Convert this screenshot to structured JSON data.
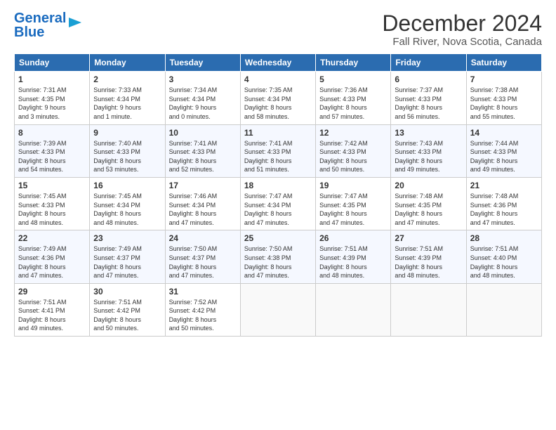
{
  "header": {
    "logo_line1": "General",
    "logo_line2": "Blue",
    "month_title": "December 2024",
    "location": "Fall River, Nova Scotia, Canada"
  },
  "days_of_week": [
    "Sunday",
    "Monday",
    "Tuesday",
    "Wednesday",
    "Thursday",
    "Friday",
    "Saturday"
  ],
  "weeks": [
    [
      {
        "day": "1",
        "info": "Sunrise: 7:31 AM\nSunset: 4:35 PM\nDaylight: 9 hours\nand 3 minutes."
      },
      {
        "day": "2",
        "info": "Sunrise: 7:33 AM\nSunset: 4:34 PM\nDaylight: 9 hours\nand 1 minute."
      },
      {
        "day": "3",
        "info": "Sunrise: 7:34 AM\nSunset: 4:34 PM\nDaylight: 9 hours\nand 0 minutes."
      },
      {
        "day": "4",
        "info": "Sunrise: 7:35 AM\nSunset: 4:34 PM\nDaylight: 8 hours\nand 58 minutes."
      },
      {
        "day": "5",
        "info": "Sunrise: 7:36 AM\nSunset: 4:33 PM\nDaylight: 8 hours\nand 57 minutes."
      },
      {
        "day": "6",
        "info": "Sunrise: 7:37 AM\nSunset: 4:33 PM\nDaylight: 8 hours\nand 56 minutes."
      },
      {
        "day": "7",
        "info": "Sunrise: 7:38 AM\nSunset: 4:33 PM\nDaylight: 8 hours\nand 55 minutes."
      }
    ],
    [
      {
        "day": "8",
        "info": "Sunrise: 7:39 AM\nSunset: 4:33 PM\nDaylight: 8 hours\nand 54 minutes."
      },
      {
        "day": "9",
        "info": "Sunrise: 7:40 AM\nSunset: 4:33 PM\nDaylight: 8 hours\nand 53 minutes."
      },
      {
        "day": "10",
        "info": "Sunrise: 7:41 AM\nSunset: 4:33 PM\nDaylight: 8 hours\nand 52 minutes."
      },
      {
        "day": "11",
        "info": "Sunrise: 7:41 AM\nSunset: 4:33 PM\nDaylight: 8 hours\nand 51 minutes."
      },
      {
        "day": "12",
        "info": "Sunrise: 7:42 AM\nSunset: 4:33 PM\nDaylight: 8 hours\nand 50 minutes."
      },
      {
        "day": "13",
        "info": "Sunrise: 7:43 AM\nSunset: 4:33 PM\nDaylight: 8 hours\nand 49 minutes."
      },
      {
        "day": "14",
        "info": "Sunrise: 7:44 AM\nSunset: 4:33 PM\nDaylight: 8 hours\nand 49 minutes."
      }
    ],
    [
      {
        "day": "15",
        "info": "Sunrise: 7:45 AM\nSunset: 4:33 PM\nDaylight: 8 hours\nand 48 minutes."
      },
      {
        "day": "16",
        "info": "Sunrise: 7:45 AM\nSunset: 4:34 PM\nDaylight: 8 hours\nand 48 minutes."
      },
      {
        "day": "17",
        "info": "Sunrise: 7:46 AM\nSunset: 4:34 PM\nDaylight: 8 hours\nand 47 minutes."
      },
      {
        "day": "18",
        "info": "Sunrise: 7:47 AM\nSunset: 4:34 PM\nDaylight: 8 hours\nand 47 minutes."
      },
      {
        "day": "19",
        "info": "Sunrise: 7:47 AM\nSunset: 4:35 PM\nDaylight: 8 hours\nand 47 minutes."
      },
      {
        "day": "20",
        "info": "Sunrise: 7:48 AM\nSunset: 4:35 PM\nDaylight: 8 hours\nand 47 minutes."
      },
      {
        "day": "21",
        "info": "Sunrise: 7:48 AM\nSunset: 4:36 PM\nDaylight: 8 hours\nand 47 minutes."
      }
    ],
    [
      {
        "day": "22",
        "info": "Sunrise: 7:49 AM\nSunset: 4:36 PM\nDaylight: 8 hours\nand 47 minutes."
      },
      {
        "day": "23",
        "info": "Sunrise: 7:49 AM\nSunset: 4:37 PM\nDaylight: 8 hours\nand 47 minutes."
      },
      {
        "day": "24",
        "info": "Sunrise: 7:50 AM\nSunset: 4:37 PM\nDaylight: 8 hours\nand 47 minutes."
      },
      {
        "day": "25",
        "info": "Sunrise: 7:50 AM\nSunset: 4:38 PM\nDaylight: 8 hours\nand 47 minutes."
      },
      {
        "day": "26",
        "info": "Sunrise: 7:51 AM\nSunset: 4:39 PM\nDaylight: 8 hours\nand 48 minutes."
      },
      {
        "day": "27",
        "info": "Sunrise: 7:51 AM\nSunset: 4:39 PM\nDaylight: 8 hours\nand 48 minutes."
      },
      {
        "day": "28",
        "info": "Sunrise: 7:51 AM\nSunset: 4:40 PM\nDaylight: 8 hours\nand 48 minutes."
      }
    ],
    [
      {
        "day": "29",
        "info": "Sunrise: 7:51 AM\nSunset: 4:41 PM\nDaylight: 8 hours\nand 49 minutes."
      },
      {
        "day": "30",
        "info": "Sunrise: 7:51 AM\nSunset: 4:42 PM\nDaylight: 8 hours\nand 50 minutes."
      },
      {
        "day": "31",
        "info": "Sunrise: 7:52 AM\nSunset: 4:42 PM\nDaylight: 8 hours\nand 50 minutes."
      },
      {
        "day": "",
        "info": ""
      },
      {
        "day": "",
        "info": ""
      },
      {
        "day": "",
        "info": ""
      },
      {
        "day": "",
        "info": ""
      }
    ]
  ]
}
